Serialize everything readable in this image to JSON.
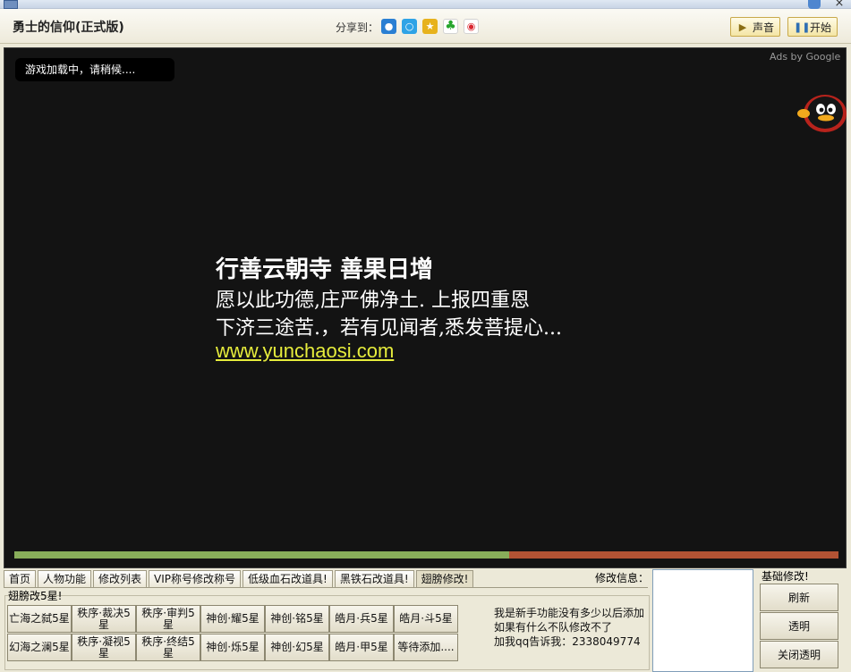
{
  "window": {
    "title": "勇士的信仰(正式版)",
    "close_symbol": "×"
  },
  "share": {
    "label": "分享到：",
    "icons": [
      "qq-icon",
      "qzone-icon",
      "pengyou-icon",
      "clover-icon",
      "weibo-icon"
    ]
  },
  "header_buttons": {
    "sound_label": "声音",
    "start_label": "开始"
  },
  "game": {
    "loading_text": "游戏加载中，请稍候....",
    "ads_label": "Ads by Google",
    "message_line1": "行善云朝寺 善果日增",
    "message_line2": "愿以此功德,庄严佛净土. 上报四重恩",
    "message_line3": "下济三途苦.，若有见闻者,悉发菩提心...",
    "message_url": "www.yunchaosi.com",
    "load_progress": 0.6,
    "colors": {
      "progress_fill": "#88ad5a",
      "progress_track": "#b25334",
      "url": "#e6ec3c"
    }
  },
  "tabs": [
    {
      "label": "首页"
    },
    {
      "label": "人物功能"
    },
    {
      "label": "修改列表"
    },
    {
      "label": "VIP称号修改称号"
    },
    {
      "label": "低级血石改道具!"
    },
    {
      "label": "黑铁石改道具!"
    },
    {
      "label": "翅膀修改!"
    }
  ],
  "active_tab": "翅膀修改!",
  "wing_group": {
    "label": "翅膀改5星!",
    "buttons": [
      "亡海之弑5星",
      "秩序·裁决5星",
      "秩序·审判5星",
      "神创·耀5星",
      "神创·铭5星",
      "皓月·兵5星",
      "皓月·斗5星",
      "幻海之澜5星",
      "秩序·凝视5星",
      "秩序·终结5星",
      "神创·烁5星",
      "神创·幻5星",
      "皓月·甲5星",
      "等待添加...."
    ]
  },
  "info_text": {
    "line1": "我是新手功能没有多少以后添加",
    "line2": "如果有什么不队修改不了",
    "line3": "加我qq告诉我：2338049774"
  },
  "modify_info": {
    "label": "修改信息："
  },
  "base_modify": {
    "label": "基础修改!",
    "buttons": [
      "刷新",
      "透明",
      "关闭透明"
    ]
  }
}
